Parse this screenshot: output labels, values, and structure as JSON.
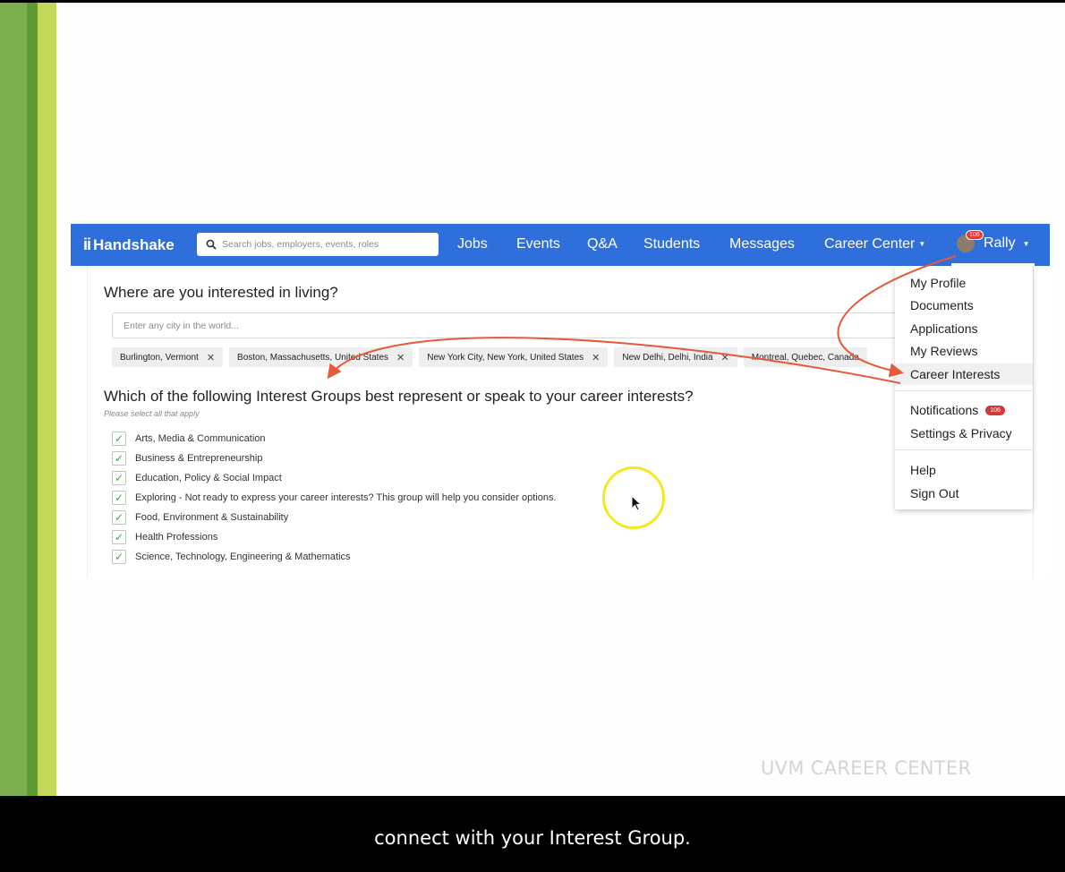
{
  "navbar": {
    "logo": "Handshake",
    "logo_mark": "ii",
    "search_placeholder": "Search jobs, employers, events, roles",
    "items": [
      "Jobs",
      "Events",
      "Q&A",
      "Students",
      "Messages",
      "Career Center"
    ],
    "user_name": "Rally",
    "user_badge": "106"
  },
  "living": {
    "heading": "Where are you interested in living?",
    "input_placeholder": "Enter any city in the world...",
    "chips": [
      "Burlington, Vermont",
      "Boston, Massachusetts, United States",
      "New York City, New York, United States",
      "New Delhi, Delhi, India",
      "Montreal, Quebec, Canada"
    ]
  },
  "interests": {
    "heading": "Which of the following Interest Groups best represent or speak to your career interests?",
    "subtext": "Please select all that apply",
    "groups": [
      "Arts, Media & Communication",
      "Business & Entrepreneurship",
      "Education, Policy & Social Impact",
      "Exploring - Not ready to express your career interests? This group will help you consider options.",
      "Food, Environment & Sustainability",
      "Health Professions",
      "Science, Technology, Engineering & Mathematics"
    ]
  },
  "menu": {
    "items": [
      "My Profile",
      "Documents",
      "Applications",
      "My Reviews",
      "Career Interests",
      "Notifications",
      "Settings & Privacy",
      "Help",
      "Sign Out"
    ],
    "notifications_badge": "106"
  },
  "colors": {
    "navbar": "#2f6fdc",
    "arrow": "#e45a3a",
    "check": "#3ea34a",
    "cursor_ring": "#f3ea20"
  },
  "watermark": "UVM CAREER CENTER",
  "caption": "connect with your Interest Group."
}
